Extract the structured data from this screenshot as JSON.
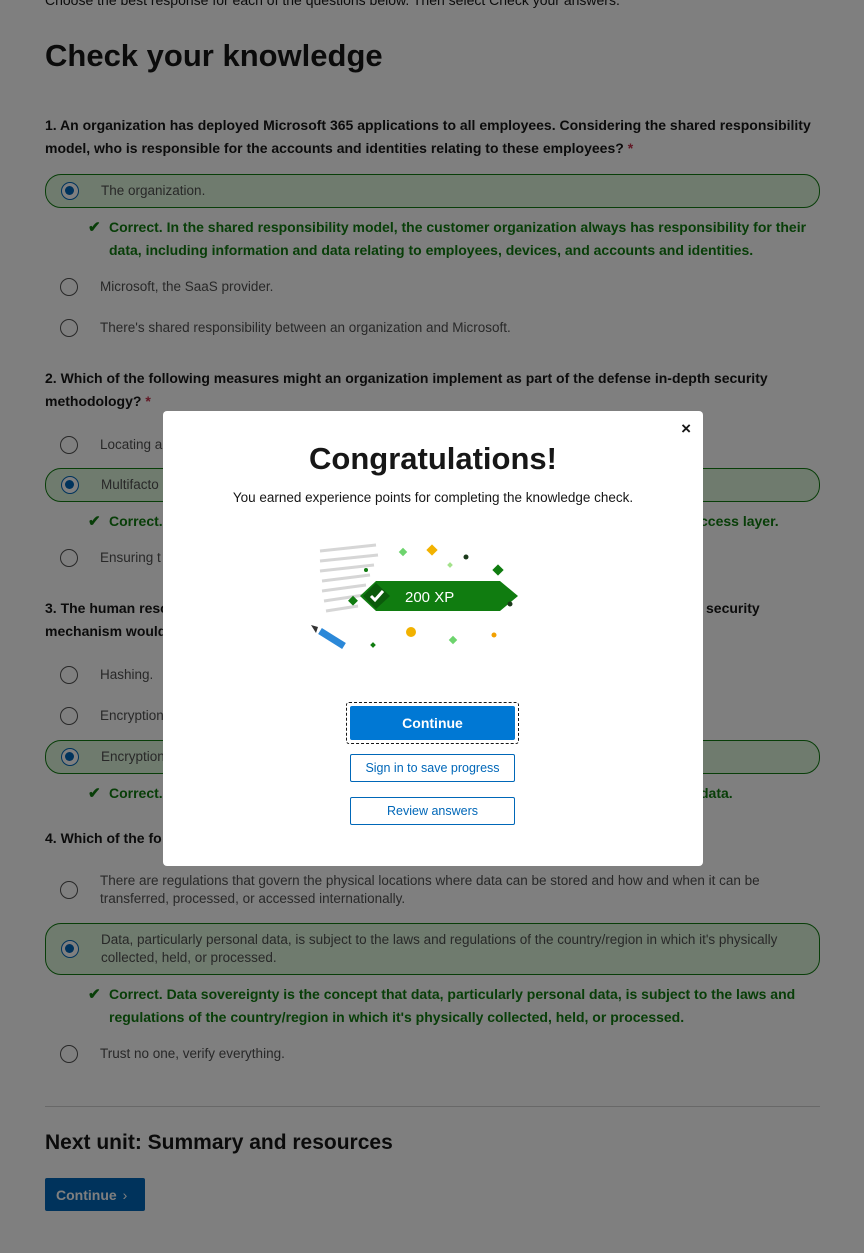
{
  "intro": "Choose the best response for each of the questions below. Then select Check your answers.",
  "page_title": "Check your knowledge",
  "required_mark": "*",
  "questions": [
    {
      "text": "1. An organization has deployed Microsoft 365 applications to all employees. Considering the shared responsibility model, who is responsible for the accounts and identities relating to these employees?",
      "options": [
        "The organization.",
        "Microsoft, the SaaS provider.",
        "There's shared responsibility between an organization and Microsoft."
      ],
      "feedback": "Correct. In the shared responsibility model, the customer organization always has responsibility for their data, including information and data relating to employees, devices, and accounts and identities."
    },
    {
      "text": "2. Which of the following measures might an organization implement as part of the defense in-depth security methodology?",
      "options": [
        "Locating a",
        "Multifacto",
        "Ensuring t"
      ],
      "feedback_start": "Correct.",
      "feedback_end": "ccess layer."
    },
    {
      "text_start": "3. The human reso",
      "text_end": "security",
      "text_line2": "mechanism would",
      "options": [
        "Hashing.",
        "Encryption",
        "Encryption"
      ],
      "feedback_start": "Correct.",
      "feedback_end": "data."
    },
    {
      "text": "4. Which of the fo",
      "options": [
        "There are regulations that govern the physical locations where data can be stored and how and when it can be transferred, processed, or accessed internationally.",
        "Data, particularly personal data, is subject to the laws and regulations of the country/region in which it's physically collected, held, or processed.",
        "Trust no one, verify everything."
      ],
      "feedback": "Correct. Data sovereignty is the concept that data, particularly personal data, is subject to the laws and regulations of the country/region in which it's physically collected, held, or processed."
    }
  ],
  "next_unit": {
    "title": "Next unit: Summary and resources",
    "button_label": "Continue",
    "chevron": "›"
  },
  "modal": {
    "close": "×",
    "title": "Congratulations!",
    "subtitle": "You earned experience points for completing the knowledge check.",
    "xp_label": "200 XP",
    "continue_label": "Continue",
    "sign_in_label": "Sign in to save progress",
    "review_label": "Review answers"
  },
  "colors": {
    "accent": "#0078d4",
    "success": "#107c10",
    "success_bg": "#dff6dd"
  }
}
